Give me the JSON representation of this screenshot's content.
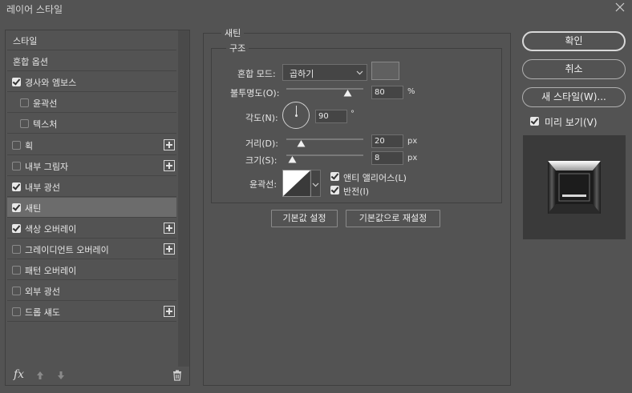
{
  "window": {
    "title": "레이어 스타일"
  },
  "styles_list": [
    {
      "label": "스타일",
      "checkbox": false,
      "indent": false,
      "plus": false,
      "checked": false,
      "selected": false
    },
    {
      "label": "혼합 옵션",
      "checkbox": false,
      "indent": false,
      "plus": false,
      "checked": false,
      "selected": false
    },
    {
      "label": "경사와 엠보스",
      "checkbox": true,
      "indent": false,
      "plus": false,
      "checked": true,
      "selected": false
    },
    {
      "label": "윤곽선",
      "checkbox": true,
      "indent": true,
      "plus": false,
      "checked": false,
      "selected": false
    },
    {
      "label": "텍스처",
      "checkbox": true,
      "indent": true,
      "plus": false,
      "checked": false,
      "selected": false
    },
    {
      "label": "획",
      "checkbox": true,
      "indent": false,
      "plus": true,
      "checked": false,
      "selected": false
    },
    {
      "label": "내부 그림자",
      "checkbox": true,
      "indent": false,
      "plus": true,
      "checked": false,
      "selected": false
    },
    {
      "label": "내부 광선",
      "checkbox": true,
      "indent": false,
      "plus": false,
      "checked": true,
      "selected": false
    },
    {
      "label": "새틴",
      "checkbox": true,
      "indent": false,
      "plus": false,
      "checked": true,
      "selected": true
    },
    {
      "label": "색상 오버레이",
      "checkbox": true,
      "indent": false,
      "plus": true,
      "checked": true,
      "selected": false
    },
    {
      "label": "그레이디언트 오버레이",
      "checkbox": true,
      "indent": false,
      "plus": true,
      "checked": false,
      "selected": false
    },
    {
      "label": "패턴 오버레이",
      "checkbox": true,
      "indent": false,
      "plus": false,
      "checked": false,
      "selected": false
    },
    {
      "label": "외부 광선",
      "checkbox": true,
      "indent": false,
      "plus": false,
      "checked": false,
      "selected": false
    },
    {
      "label": "드롭 섀도",
      "checkbox": true,
      "indent": false,
      "plus": true,
      "checked": false,
      "selected": false
    }
  ],
  "bottom_tools": {
    "fx": "fx"
  },
  "satin": {
    "group_title": "새틴",
    "structure_title": "구조",
    "blend_mode_label": "혼합 모드:",
    "blend_mode_value": "곱하기",
    "blend_color": "#606060",
    "opacity_label": "불투명도(O):",
    "opacity_value": "80",
    "opacity_unit": "%",
    "angle_label": "각도(N):",
    "angle_value": "90",
    "angle_unit": "°",
    "distance_label": "거리(D):",
    "distance_value": "20",
    "distance_unit": "px",
    "size_label": "크기(S):",
    "size_value": "8",
    "size_unit": "px",
    "contour_label": "윤곽선:",
    "antialias_label": "앤티 앨리어스(L)",
    "antialias_checked": true,
    "invert_label": "반전(I)",
    "invert_checked": true,
    "make_default": "기본값 설정",
    "reset_default": "기본값으로 재설정"
  },
  "buttons": {
    "ok": "확인",
    "cancel": "취소",
    "new_style": "새 스타일(W)...",
    "preview_label": "미리 보기(V)",
    "preview_checked": true
  }
}
